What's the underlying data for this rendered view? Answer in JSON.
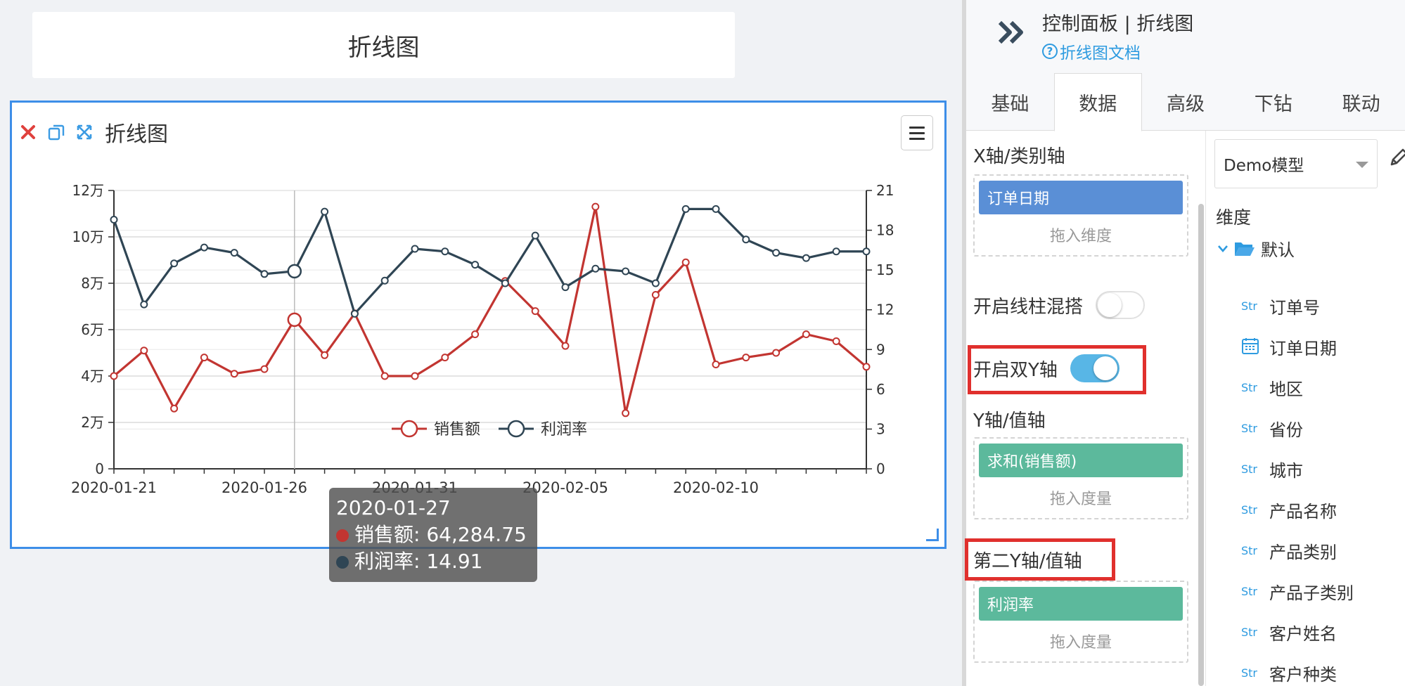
{
  "title_card": {
    "text": "折线图"
  },
  "chart_card": {
    "name": "折线图"
  },
  "tooltip": {
    "date": "2020-01-27",
    "series1_label": "销售额: 64,284.75",
    "series2_label": "利润率: 14.91"
  },
  "legend": [
    {
      "name": "销售额",
      "color": "#c23531"
    },
    {
      "name": "利润率",
      "color": "#2f4554"
    }
  ],
  "chart_data": {
    "type": "line",
    "x": [
      "2020-01-21",
      "2020-01-22",
      "2020-01-23",
      "2020-01-24",
      "2020-01-25",
      "2020-01-26",
      "2020-01-27",
      "2020-01-28",
      "2020-01-29",
      "2020-01-30",
      "2020-01-31",
      "2020-02-01",
      "2020-02-02",
      "2020-02-03",
      "2020-02-04",
      "2020-02-05",
      "2020-02-06",
      "2020-02-07",
      "2020-02-08",
      "2020-02-09",
      "2020-02-10",
      "2020-02-11",
      "2020-02-12",
      "2020-02-13",
      "2020-02-14",
      "2020-02-15"
    ],
    "x_tick_labels": [
      "2020-01-21",
      "2020-01-26",
      "2020-01-31",
      "2020-02-05",
      "2020-02-10"
    ],
    "y_left_ticks": [
      "0",
      "2万",
      "4万",
      "6万",
      "8万",
      "10万",
      "12万"
    ],
    "y_left_range": [
      0,
      120000
    ],
    "y_right_ticks": [
      "0",
      "3",
      "6",
      "9",
      "12",
      "15",
      "18",
      "21"
    ],
    "y_right_range": [
      0,
      21
    ],
    "series": [
      {
        "name": "销售额",
        "axis": "left",
        "color": "#c23531",
        "values": [
          40000,
          51000,
          26000,
          48000,
          41000,
          43000,
          64284.75,
          49000,
          67000,
          40000,
          40000,
          48000,
          58000,
          81000,
          68000,
          53000,
          113000,
          24000,
          75000,
          89000,
          45000,
          48000,
          50000,
          58000,
          55000,
          44000
        ]
      },
      {
        "name": "利润率",
        "axis": "right",
        "color": "#2f4554",
        "values": [
          18.8,
          12.4,
          15.5,
          16.7,
          16.3,
          14.7,
          14.91,
          19.4,
          11.7,
          14.2,
          16.6,
          16.4,
          15.4,
          14.0,
          17.6,
          13.7,
          15.1,
          14.9,
          14.0,
          19.6,
          19.6,
          17.3,
          16.3,
          15.9,
          16.4,
          16.4
        ]
      }
    ],
    "highlight_index": 6,
    "grid": true,
    "legend_position": "bottom-center"
  },
  "panel": {
    "title": "控制面板 | 折线图",
    "doc_link": "折线图文档",
    "tabs": [
      {
        "label": "基础",
        "active": false
      },
      {
        "label": "数据",
        "active": true
      },
      {
        "label": "高级",
        "active": false
      },
      {
        "label": "下钻",
        "active": false
      },
      {
        "label": "联动",
        "active": false
      }
    ],
    "x_axis_label": "X轴/类别轴",
    "x_axis_chip": "订单日期",
    "dim_hint": "拖入维度",
    "mix_toggle_label": "开启线柱混搭",
    "dual_y_label": "开启双Y轴",
    "y_axis_label": "Y轴/值轴",
    "y_axis_chip": "求和(销售额)",
    "measure_hint": "拖入度量",
    "second_y_label": "第二Y轴/值轴",
    "second_y_chip": "利润率",
    "measure_hint2": "拖入度量",
    "model": "Demo模型",
    "dimension_label": "维度",
    "folder": "默认",
    "fields": [
      {
        "type": "Str",
        "name": "订单号"
      },
      {
        "type": "date",
        "name": "订单日期"
      },
      {
        "type": "Str",
        "name": "地区"
      },
      {
        "type": "Str",
        "name": "省份"
      },
      {
        "type": "Str",
        "name": "城市"
      },
      {
        "type": "Str",
        "name": "产品名称"
      },
      {
        "type": "Str",
        "name": "产品类别"
      },
      {
        "type": "Str",
        "name": "产品子类别"
      },
      {
        "type": "Str",
        "name": "客户姓名"
      },
      {
        "type": "Str",
        "name": "客户种类"
      }
    ]
  }
}
